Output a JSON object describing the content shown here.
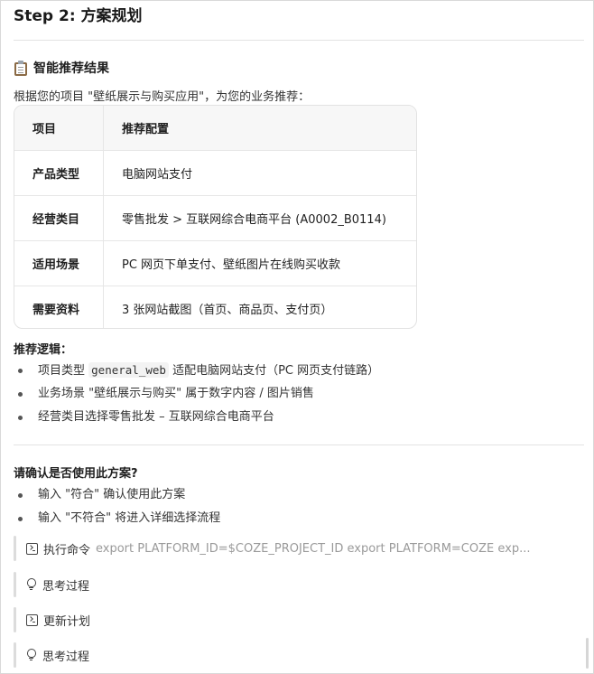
{
  "step": {
    "title": "Step 2: 方案规划"
  },
  "recommendation": {
    "section_title": "智能推荐结果",
    "section_icon": "clipboard-icon",
    "intro": "根据您的项目 \"壁纸展示与购买应用\"，为您的业务推荐：",
    "table": {
      "headers": [
        "项目",
        "推荐配置"
      ],
      "rows": [
        {
          "key": "产品类型",
          "value": "电脑网站支付"
        },
        {
          "key": "经营类目",
          "value": "零售批发 > 互联网综合电商平台 (A0002_B0114)"
        },
        {
          "key": "适用场景",
          "value": "PC 网页下单支付、壁纸图片在线购买收款"
        },
        {
          "key": "需要资料",
          "value": "3 张网站截图（首页、商品页、支付页）"
        }
      ]
    }
  },
  "logic": {
    "title": "推荐逻辑：",
    "items": [
      {
        "before": "项目类型 ",
        "code": "general_web",
        "after": " 适配电脑网站支付（PC 网页支付链路）"
      },
      {
        "text": "业务场景 \"壁纸展示与购买\" 属于数字内容 / 图片销售"
      },
      {
        "text": "经营类目选择零售批发 – 互联网综合电商平台"
      }
    ]
  },
  "confirm": {
    "title": "请确认是否使用此方案?",
    "items": [
      "输入 \"符合\" 确认使用此方案",
      "输入 \"不符合\" 将进入详细选择流程"
    ]
  },
  "steps": [
    {
      "icon": "terminal-icon",
      "label": "执行命令",
      "detail": "export PLATFORM_ID=$COZE_PROJECT_ID export PLATFORM=COZE exp..."
    },
    {
      "icon": "lightbulb-icon",
      "label": "思考过程"
    },
    {
      "icon": "terminal-icon",
      "label": "更新计划"
    },
    {
      "icon": "lightbulb-icon",
      "label": "思考过程"
    }
  ]
}
